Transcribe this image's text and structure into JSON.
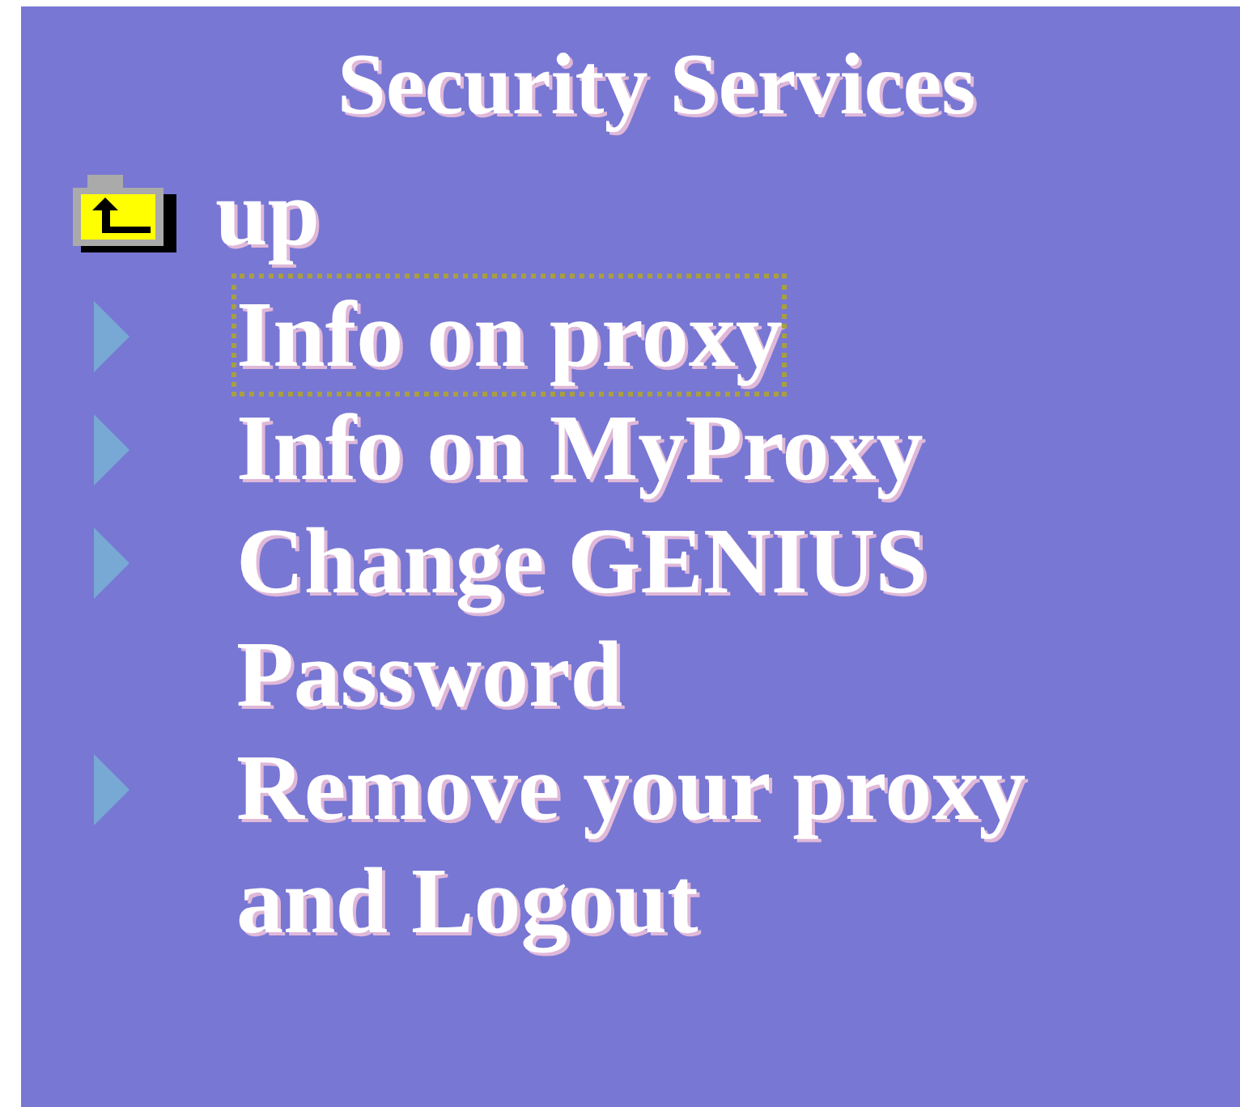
{
  "title": "Security Services",
  "up": {
    "label": "up"
  },
  "items": [
    {
      "label": "Info on proxy",
      "focused": true
    },
    {
      "label": "Info on MyProxy",
      "focused": false
    },
    {
      "label": "Change GENIUS Password",
      "focused": false
    },
    {
      "label": "Remove your proxy and Logout",
      "focused": false
    }
  ]
}
